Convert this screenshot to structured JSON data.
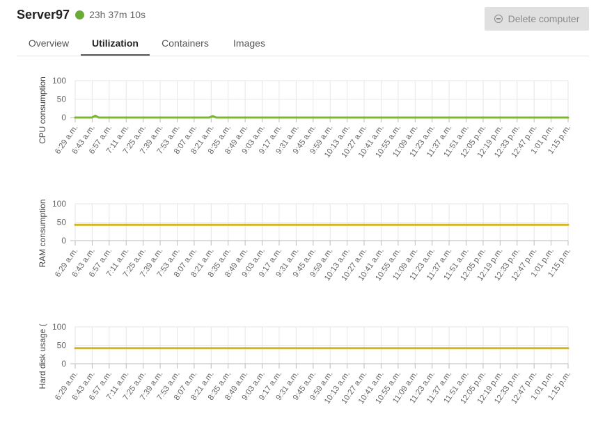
{
  "header": {
    "server_name": "Server97",
    "uptime": "23h 37m 10s",
    "status_color": "#6aaa36",
    "delete_label": "Delete computer",
    "delete_icon": "minus-circle-icon"
  },
  "tabs": [
    {
      "label": "Overview",
      "active": false
    },
    {
      "label": "Utilization",
      "active": true
    },
    {
      "label": "Containers",
      "active": false
    },
    {
      "label": "Images",
      "active": false
    }
  ],
  "chart_data": [
    {
      "type": "line",
      "ylabel": "CPU consumption",
      "ylim": [
        0,
        100
      ],
      "yticks": [
        0,
        50,
        100
      ],
      "grid": true,
      "color": "#7cb82f",
      "xticks": [
        "6:29 a.m.",
        "6:43 a.m.",
        "6:57 a.m.",
        "7:11 a.m.",
        "7:25 a.m.",
        "7:39 a.m.",
        "7:53 a.m.",
        "8:07 a.m.",
        "8:21 a.m.",
        "8:35 a.m.",
        "8:49 a.m.",
        "9:03 a.m.",
        "9:17 a.m.",
        "9:31 a.m.",
        "9:45 a.m.",
        "9:59 a.m.",
        "10:13 a.m.",
        "10:27 a.m.",
        "10:41 a.m.",
        "10:55 a.m.",
        "11:09 a.m.",
        "11:23 a.m.",
        "11:37 a.m.",
        "11:51 a.m.",
        "12:05 p.m.",
        "12:19 p.m.",
        "12:33 p.m.",
        "12:47 p.m.",
        "1:01 p.m.",
        "1:15 p.m."
      ],
      "values": [
        0,
        0,
        0,
        0,
        0,
        0,
        5,
        0,
        0,
        0,
        0,
        0,
        0,
        0,
        0,
        0,
        0,
        0,
        0,
        0,
        0,
        0,
        0,
        0,
        0,
        0,
        0,
        0,
        0,
        0,
        0,
        0,
        0,
        0,
        0,
        0,
        0,
        0,
        0,
        0,
        0,
        4,
        0,
        0,
        0,
        0,
        0,
        0,
        0,
        0,
        0,
        0,
        0,
        0,
        0,
        0,
        0,
        0,
        0,
        0,
        0,
        0,
        0,
        0,
        0,
        0,
        0,
        0,
        0,
        0,
        0,
        0,
        0,
        0,
        0,
        0,
        0,
        0,
        0,
        0,
        0,
        0,
        0,
        0,
        0,
        0,
        0,
        0,
        0,
        0,
        0,
        0,
        0,
        0,
        0,
        0,
        0,
        0,
        0,
        0,
        0,
        0,
        0,
        0,
        0,
        0,
        0,
        0,
        0,
        0,
        0,
        0,
        0,
        0,
        0,
        0,
        0,
        0,
        0,
        0,
        0,
        0,
        0,
        0,
        0,
        0,
        0,
        0,
        0,
        0,
        0,
        0,
        0,
        0,
        0,
        0,
        0,
        0,
        0,
        0,
        0,
        0,
        0,
        0,
        0,
        0,
        0,
        0
      ]
    },
    {
      "type": "line",
      "ylabel": "RAM consumption",
      "ylim": [
        0,
        100
      ],
      "yticks": [
        0,
        50,
        100
      ],
      "grid": true,
      "color": "#d4b71e",
      "xticks": [
        "6:29 a.m.",
        "6:43 a.m.",
        "6:57 a.m.",
        "7:11 a.m.",
        "7:25 a.m.",
        "7:39 a.m.",
        "7:53 a.m.",
        "8:07 a.m.",
        "8:21 a.m.",
        "8:35 a.m.",
        "8:49 a.m.",
        "9:03 a.m.",
        "9:17 a.m.",
        "9:31 a.m.",
        "9:45 a.m.",
        "9:59 a.m.",
        "10:13 a.m.",
        "10:27 a.m.",
        "10:41 a.m.",
        "10:55 a.m.",
        "11:09 a.m.",
        "11:23 a.m.",
        "11:37 a.m.",
        "11:51 a.m.",
        "12:05 p.m.",
        "12:19 p.m.",
        "12:33 p.m.",
        "12:47 p.m.",
        "1:01 p.m.",
        "1:15 p.m."
      ],
      "values": [
        43,
        43
      ]
    },
    {
      "type": "line",
      "ylabel": "Hard disk usage (",
      "ylim": [
        0,
        100
      ],
      "yticks": [
        0,
        50,
        100
      ],
      "grid": true,
      "color": "#d4b71e",
      "xticks": [
        "6:29 a.m.",
        "6:43 a.m.",
        "6:57 a.m.",
        "7:11 a.m.",
        "7:25 a.m.",
        "7:39 a.m.",
        "7:53 a.m.",
        "8:07 a.m.",
        "8:21 a.m.",
        "8:35 a.m.",
        "8:49 a.m.",
        "9:03 a.m.",
        "9:17 a.m.",
        "9:31 a.m.",
        "9:45 a.m.",
        "9:59 a.m.",
        "10:13 a.m.",
        "10:27 a.m.",
        "10:41 a.m.",
        "10:55 a.m.",
        "11:09 a.m.",
        "11:23 a.m.",
        "11:37 a.m.",
        "11:51 a.m.",
        "12:05 p.m.",
        "12:19 p.m.",
        "12:33 p.m.",
        "12:47 p.m.",
        "1:01 p.m.",
        "1:15 p.m."
      ],
      "values": [
        42,
        42
      ]
    }
  ]
}
